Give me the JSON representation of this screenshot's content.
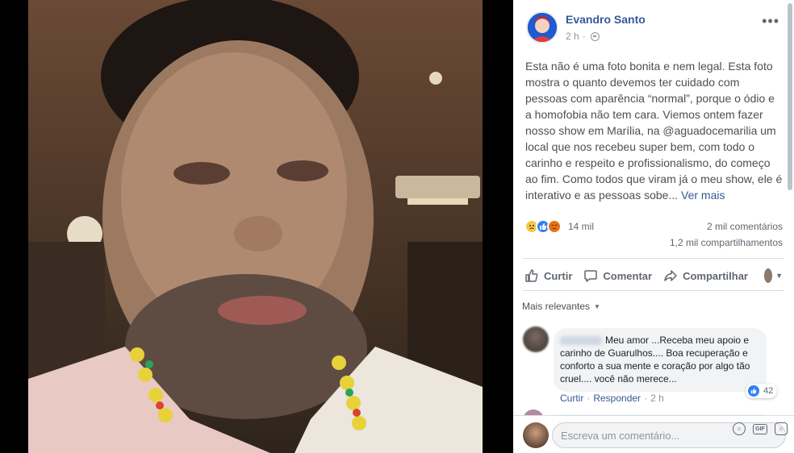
{
  "post": {
    "author": "Evandro Santo",
    "time": "2 h",
    "text": "Esta não é uma foto bonita e nem legal. Esta foto mostra o quanto devemos ter cuidado com pessoas com aparência “normal”, porque o ódio e a homofobia não tem cara. Viemos ontem fazer nosso show em Marília, na @aguadocemarilia um local que nos recebeu super bem, com todo o carinho e respeito e profissionalismo, do começo ao fim. Como todos que viram já o meu show, ele é interativo e as pessoas sobe...",
    "see_more": "Ver mais",
    "more_icon": "more-options-icon"
  },
  "stats": {
    "reaction_icons": [
      "sad",
      "like",
      "angry"
    ],
    "reactions": "14 mil",
    "comments": "2 mil comentários",
    "shares": "1,2 mil compartilhamentos"
  },
  "actions": {
    "like": "Curtir",
    "comment": "Comentar",
    "share": "Compartilhar"
  },
  "sort": {
    "label": "Mais relevantes"
  },
  "comment": {
    "text": "Meu amor ...Receba meu apoio e carinho de Guarulhos.... Boa recuperação e conforto a sua mente e coração por algo tão cruel.... você não merece...",
    "likes": "42",
    "like_action": "Curtir",
    "reply_action": "Responder",
    "separator": "·",
    "time": "2 h"
  },
  "composer": {
    "placeholder": "Escreva um comentário..."
  },
  "colors": {
    "link": "#365899",
    "like_blue": "#2e81f4",
    "sad_yellow": "#f7c843",
    "angry_orange": "#e9710f"
  }
}
